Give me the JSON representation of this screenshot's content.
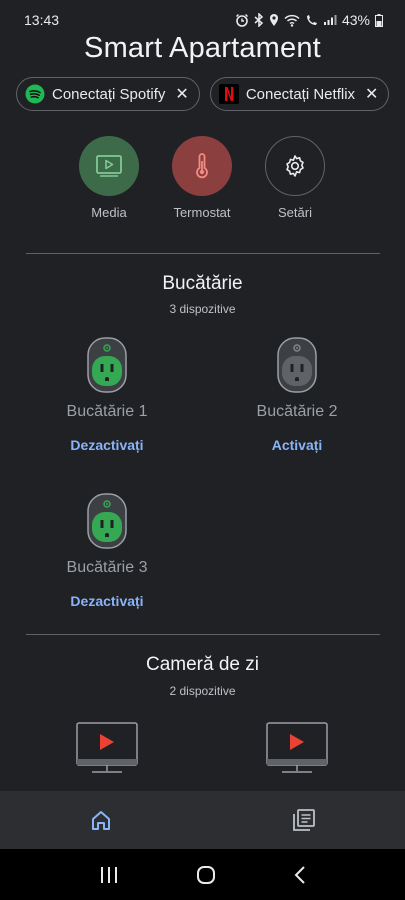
{
  "status_bar": {
    "time": "13:43",
    "battery": "43%"
  },
  "app_title": "Smart Apartament",
  "chips": [
    {
      "label": "Conectați Spotify",
      "icon": "spotify-icon",
      "close_icon": "close-icon"
    },
    {
      "label": "Conectați Netflix",
      "icon": "netflix-icon",
      "close_icon": "close-icon"
    }
  ],
  "quick_actions": [
    {
      "label": "Media",
      "icon": "media-play-icon",
      "color": "#3d6b4a"
    },
    {
      "label": "Termostat",
      "icon": "thermometer-icon",
      "color": "#8c3f3f"
    },
    {
      "label": "Setări",
      "icon": "gear-icon",
      "color": "#202124"
    }
  ],
  "rooms": [
    {
      "name": "Bucătărie",
      "count": "3 dispozitive",
      "devices": [
        {
          "name": "Bucătărie 1",
          "action": "Dezactivați",
          "state": "on",
          "icon": "smart-plug-icon"
        },
        {
          "name": "Bucătărie 2",
          "action": "Activați",
          "state": "off",
          "icon": "smart-plug-icon"
        },
        {
          "name": "Bucătărie 3",
          "action": "Dezactivați",
          "state": "on",
          "icon": "smart-plug-icon"
        }
      ]
    },
    {
      "name": "Cameră de zi",
      "count": "2 dispozitive",
      "devices": [
        {
          "icon": "tv-play-icon"
        },
        {
          "icon": "tv-play-icon"
        }
      ]
    }
  ],
  "bottom_nav": [
    {
      "icon": "home-icon",
      "active": true
    },
    {
      "icon": "list-icon",
      "active": false
    }
  ],
  "system_nav": [
    "recents-icon",
    "home-circle-icon",
    "back-icon"
  ],
  "colors": {
    "accent": "#8ab4f8",
    "plug_on": "#34a853",
    "plug_off": "#5f6368",
    "tv_red": "#ea4335"
  }
}
